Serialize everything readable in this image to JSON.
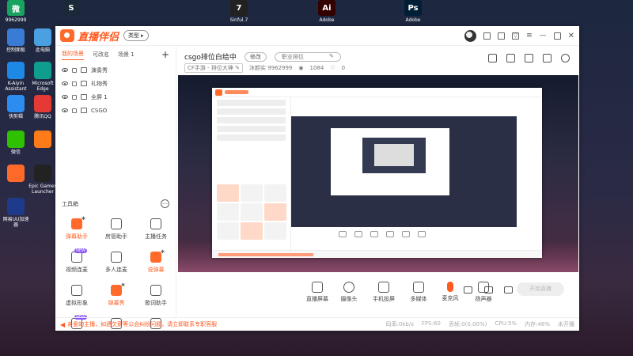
{
  "desktop": {
    "top_icons": [
      {
        "label": "9962999",
        "color": "#1aa260",
        "glyph": "微"
      },
      {
        "label": "",
        "color": "#1b2838",
        "glyph": "S"
      },
      {
        "label": "Sinful.7",
        "color": "#222",
        "glyph": "7"
      },
      {
        "label": "Adobe",
        "color": "#330000",
        "glyph": "Ai"
      },
      {
        "label": "Adobe",
        "color": "#001e36",
        "glyph": "Ps"
      }
    ],
    "side_icons": [
      {
        "label": "控制面板",
        "color": "#3a7bd5"
      },
      {
        "label": "此电脑",
        "color": "#4aa0e0"
      },
      {
        "label": "K-Aiyin Assistant",
        "color": "#1e88e5"
      },
      {
        "label": "Microsoft Edge",
        "color": "#0f9d8f"
      },
      {
        "label": "快剪辑",
        "color": "#2d8cf0"
      },
      {
        "label": "腾讯QQ",
        "color": "#e53935"
      },
      {
        "label": "微信",
        "color": "#2dc100"
      },
      {
        "label": "",
        "color": "#ff7b1a"
      },
      {
        "label": "",
        "color": "#ff6a2b"
      },
      {
        "label": "Epic Games Launcher",
        "color": "#222"
      },
      {
        "label": "网易UU加速器",
        "color": "#1e3a8a"
      }
    ]
  },
  "app": {
    "logo_text": "直播伴侣",
    "type_button": "类型",
    "scene_tabs": [
      "我的场景",
      "可改名",
      "场景 1"
    ],
    "sources": [
      "演奏秀",
      "礼物秀",
      "全屏 1",
      "CSGO"
    ],
    "tools_title": "工具箱",
    "tools": [
      {
        "label": "弹幕助手",
        "orange": true
      },
      {
        "label": "房管助手",
        "orange": false
      },
      {
        "label": "主播任务",
        "orange": false
      },
      {
        "label": "视频连麦",
        "orange": false,
        "badge": "NEW"
      },
      {
        "label": "多人连麦",
        "orange": false
      },
      {
        "label": "说弹幕",
        "orange": true
      },
      {
        "label": "虚拟形象",
        "orange": false
      },
      {
        "label": "弹幕秀",
        "orange": true
      },
      {
        "label": "歌词助手",
        "orange": false
      },
      {
        "label": "",
        "orange": false,
        "badge": "NEW"
      },
      {
        "label": "",
        "orange": false
      },
      {
        "label": "",
        "orange": false
      }
    ],
    "room": {
      "title": "csgo排位白给中",
      "edit_label": "修改",
      "category_label": "职业排位",
      "game_tag": "CF手游 - 排位大神",
      "room_id": "沐颜实 9962999",
      "viewers": "1084",
      "likes": "0"
    },
    "controls": [
      {
        "label": "直播屏幕"
      },
      {
        "label": "摄像头"
      },
      {
        "label": "手机投屏"
      },
      {
        "label": "多媒体"
      },
      {
        "label": "麦克风"
      },
      {
        "label": "扬声器"
      }
    ],
    "start_button": "开始直播",
    "notice": "亲爱的主播，如遇欠薪等公会纠纷问题，请立即联系专职客服",
    "stats": [
      "码率:0kb/s",
      "FPS:60",
      "丢帧:0(0.00%)",
      "CPU:5%",
      "内存:46%",
      "未开播"
    ]
  }
}
